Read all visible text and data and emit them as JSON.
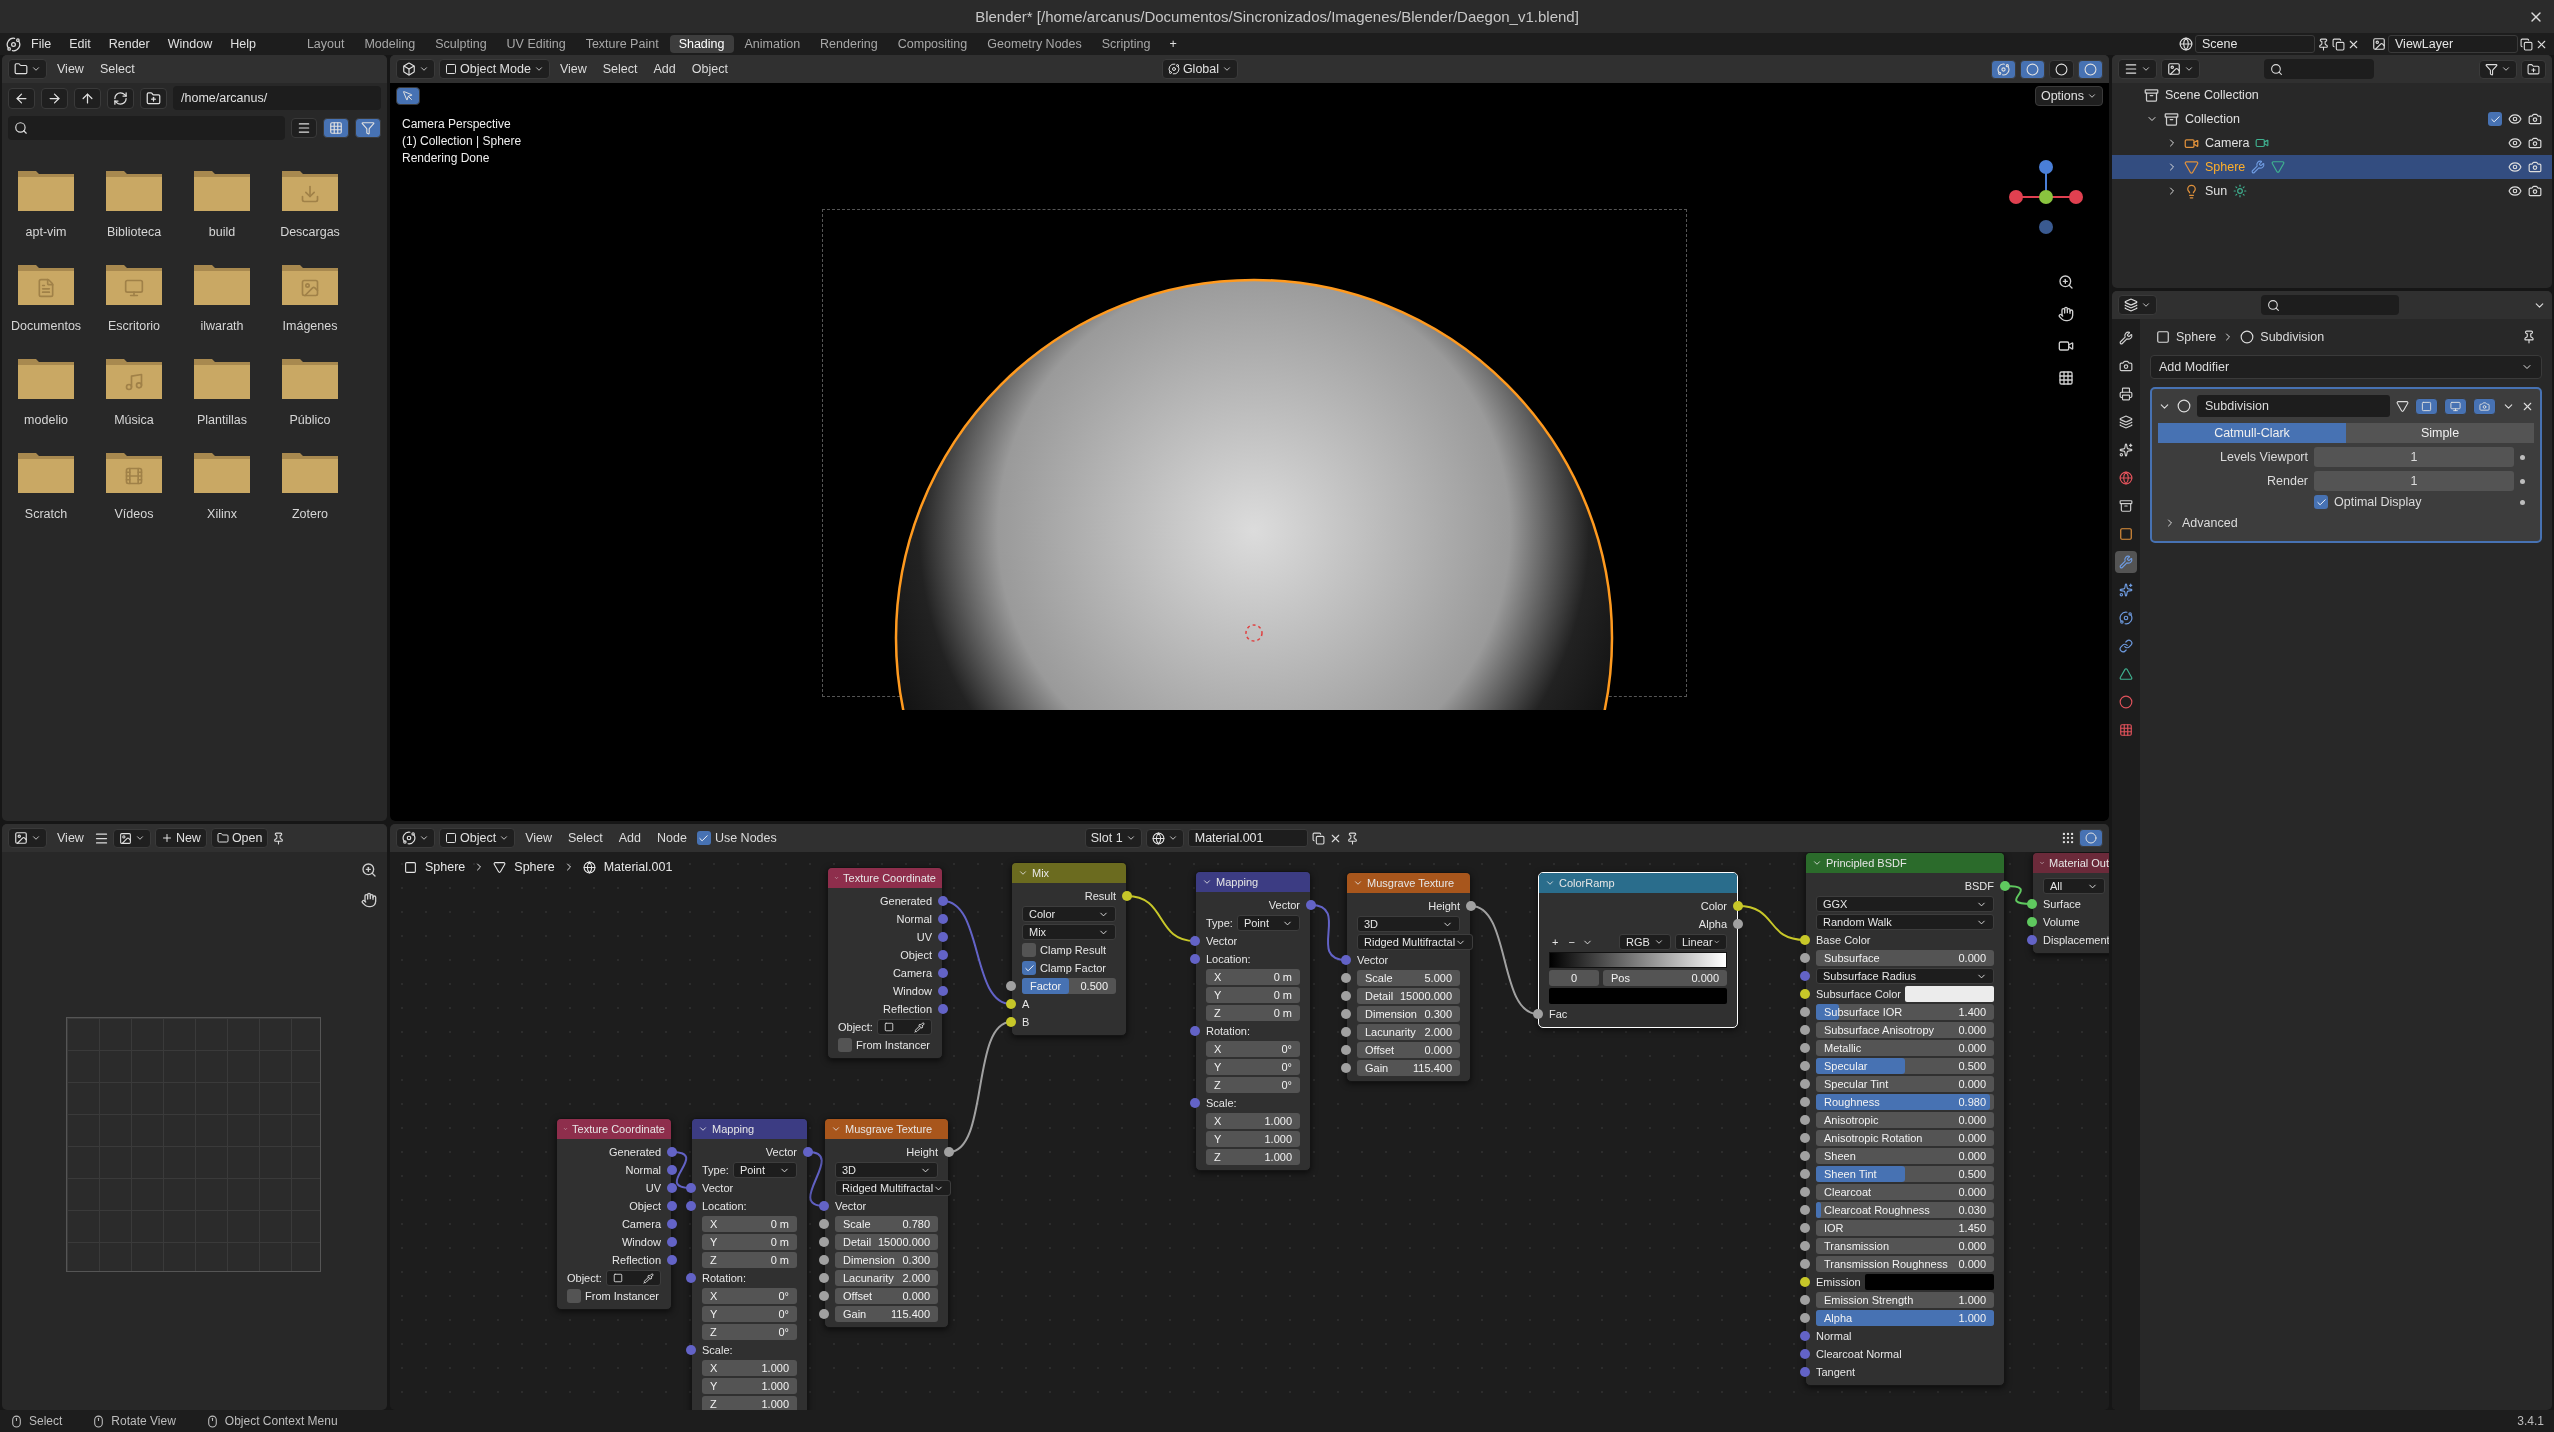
{
  "window": {
    "title": "Blender* [/home/arcanus/Documentos/Sincronizados/Imagenes/Blender/Daegon_v1.blend]"
  },
  "menu": [
    "File",
    "Edit",
    "Render",
    "Window",
    "Help"
  ],
  "workspaces": [
    {
      "label": "Layout",
      "selected": false
    },
    {
      "label": "Modeling",
      "selected": false
    },
    {
      "label": "Sculpting",
      "selected": false
    },
    {
      "label": "UV Editing",
      "selected": false
    },
    {
      "label": "Texture Paint",
      "selected": false
    },
    {
      "label": "Shading",
      "selected": true
    },
    {
      "label": "Animation",
      "selected": false
    },
    {
      "label": "Rendering",
      "selected": false
    },
    {
      "label": "Compositing",
      "selected": false
    },
    {
      "label": "Geometry Nodes",
      "selected": false
    },
    {
      "label": "Scripting",
      "selected": false
    }
  ],
  "workspace_add": "+",
  "scene": "Scene",
  "view_layer": "ViewLayer",
  "file_browser": {
    "menu": [
      "View",
      "Select"
    ],
    "path": "/home/arcanus/",
    "folders": [
      {
        "name": "apt-vim",
        "kind": "plain"
      },
      {
        "name": "Biblioteca",
        "kind": "plain"
      },
      {
        "name": "build",
        "kind": "plain"
      },
      {
        "name": "Descargas",
        "kind": "downloads"
      },
      {
        "name": "Documentos",
        "kind": "documents"
      },
      {
        "name": "Escritorio",
        "kind": "desktop"
      },
      {
        "name": "ilwarath",
        "kind": "plain"
      },
      {
        "name": "Imágenes",
        "kind": "pictures"
      },
      {
        "name": "modelio",
        "kind": "plain"
      },
      {
        "name": "Música",
        "kind": "music"
      },
      {
        "name": "Plantillas",
        "kind": "plain"
      },
      {
        "name": "Público",
        "kind": "plain"
      },
      {
        "name": "Scratch",
        "kind": "plain"
      },
      {
        "name": "Vídeos",
        "kind": "videos"
      },
      {
        "name": "Xilinx",
        "kind": "plain"
      },
      {
        "name": "Zotero",
        "kind": "plain"
      }
    ]
  },
  "image_editor": {
    "menu": [
      "View"
    ],
    "new": "New",
    "open": "Open"
  },
  "viewport": {
    "mode": "Object Mode",
    "menu": [
      "View",
      "Select",
      "Add",
      "Object"
    ],
    "orientation": "Global",
    "options": "Options",
    "overlay": [
      "Camera Perspective",
      "(1) Collection | Sphere",
      "Rendering Done"
    ]
  },
  "node_editor": {
    "type": "Object",
    "menu": [
      "View",
      "Select",
      "Add",
      "Node"
    ],
    "use_nodes": {
      "label": "Use Nodes",
      "checked": true
    },
    "slot": "Slot 1",
    "material": "Material.001",
    "breadcrumbs": [
      "Sphere",
      "Sphere",
      "Material.001"
    ],
    "nodes": [
      {
        "title": "Texture Coordinate",
        "color": "#8e2e4c",
        "selected": false,
        "rows": [
          {
            "kind": "output",
            "label": "Generated",
            "color": "#6363c7"
          },
          {
            "kind": "output",
            "label": "Normal",
            "color": "#6363c7"
          },
          {
            "kind": "output",
            "label": "UV",
            "color": "#6363c7"
          },
          {
            "kind": "output",
            "label": "Object",
            "color": "#6363c7"
          },
          {
            "kind": "output",
            "label": "Camera",
            "color": "#6363c7"
          },
          {
            "kind": "output",
            "label": "Window",
            "color": "#6363c7"
          },
          {
            "kind": "output",
            "label": "Reflection",
            "color": "#6363c7"
          },
          {
            "kind": "object",
            "label": "Object:"
          },
          {
            "kind": "checkbox",
            "label": "From Instancer",
            "checked": false
          }
        ]
      },
      {
        "title": "Mix",
        "color": "#6b6b1f",
        "selected": false,
        "rows": [
          {
            "kind": "output",
            "label": "Result",
            "color": "#c7c729"
          },
          {
            "kind": "select",
            "value": "Color"
          },
          {
            "kind": "select",
            "value": "Mix"
          },
          {
            "kind": "checkbox",
            "label": "Clamp Result",
            "checked": false
          },
          {
            "kind": "checkbox",
            "label": "Clamp Factor",
            "checked": true
          },
          {
            "kind": "value",
            "label": "Factor",
            "value": "0.500",
            "level": 0.5,
            "color": "#a1a1a1"
          },
          {
            "kind": "input",
            "label": "A",
            "color": "#c7c729"
          },
          {
            "kind": "input",
            "label": "B",
            "color": "#c7c729"
          }
        ]
      },
      {
        "title": "Mapping",
        "color": "#3c3c83",
        "selected": false,
        "rows": [
          {
            "kind": "output",
            "label": "Vector",
            "color": "#6363c7"
          },
          {
            "kind": "select",
            "label": "Type:",
            "value": "Point"
          },
          {
            "kind": "input",
            "label": "Vector",
            "color": "#6363c7"
          },
          {
            "kind": "input",
            "label": "Location:",
            "color": "#6363c7"
          },
          {
            "kind": "value",
            "label": "X",
            "value": "0 m"
          },
          {
            "kind": "value",
            "label": "Y",
            "value": "0 m"
          },
          {
            "kind": "value",
            "label": "Z",
            "value": "0 m"
          },
          {
            "kind": "input",
            "label": "Rotation:",
            "color": "#6363c7"
          },
          {
            "kind": "value",
            "label": "X",
            "value": "0°"
          },
          {
            "kind": "value",
            "label": "Y",
            "value": "0°"
          },
          {
            "kind": "value",
            "label": "Z",
            "value": "0°"
          },
          {
            "kind": "input",
            "label": "Scale:",
            "color": "#6363c7"
          },
          {
            "kind": "value",
            "label": "X",
            "value": "1.000"
          },
          {
            "kind": "value",
            "label": "Y",
            "value": "1.000"
          },
          {
            "kind": "value",
            "label": "Z",
            "value": "1.000"
          }
        ]
      },
      {
        "title": "Musgrave Texture",
        "color": "#a8561c",
        "selected": false,
        "rows": [
          {
            "kind": "output",
            "label": "Height",
            "color": "#a1a1a1"
          },
          {
            "kind": "select",
            "value": "3D"
          },
          {
            "kind": "select",
            "value": "Ridged Multifractal"
          },
          {
            "kind": "input",
            "label": "Vector",
            "color": "#6363c7"
          },
          {
            "kind": "value",
            "label": "Scale",
            "value": "5.000",
            "color": "#a1a1a1"
          },
          {
            "kind": "value",
            "label": "Detail",
            "value": "15000.000",
            "color": "#a1a1a1"
          },
          {
            "kind": "value",
            "label": "Dimension",
            "value": "0.300",
            "color": "#a1a1a1"
          },
          {
            "kind": "value",
            "label": "Lacunarity",
            "value": "2.000",
            "color": "#a1a1a1"
          },
          {
            "kind": "value",
            "label": "Offset",
            "value": "0.000",
            "color": "#a1a1a1"
          },
          {
            "kind": "value",
            "label": "Gain",
            "value": "115.400",
            "color": "#a1a1a1"
          }
        ]
      },
      {
        "title": "ColorRamp",
        "color": "#2a6d8c",
        "selected": true,
        "rows": [
          {
            "kind": "output",
            "label": "Color",
            "color": "#c7c729"
          },
          {
            "kind": "output",
            "label": "Alpha",
            "color": "#a1a1a1"
          },
          {
            "kind": "ramp_tools",
            "items": [
              "+",
              "−"
            ],
            "selects": [
              "RGB",
              "Linear"
            ]
          },
          {
            "kind": "ramp"
          },
          {
            "kind": "ramp_fields",
            "index": "0",
            "label": "Pos",
            "value": "0.000"
          },
          {
            "kind": "swatch",
            "swatch": {
              "color": "#000000"
            }
          },
          {
            "kind": "input",
            "label": "Fac",
            "color": "#a1a1a1"
          }
        ]
      },
      {
        "title": "Principled BSDF",
        "color": "#2b6b2b",
        "selected": false,
        "rows": [
          {
            "kind": "output",
            "label": "BSDF",
            "color": "#5fc95f"
          },
          {
            "kind": "select",
            "value": "GGX"
          },
          {
            "kind": "select",
            "value": "Random Walk"
          },
          {
            "kind": "input",
            "label": "Base Color",
            "color": "#c7c729"
          },
          {
            "kind": "value",
            "label": "Subsurface",
            "value": "0.000",
            "color": "#a1a1a1"
          },
          {
            "kind": "select",
            "value": "Subsurface Radius",
            "color": "#6363c7"
          },
          {
            "kind": "swatch",
            "label": "Subsurface Color",
            "color": "#c7c729",
            "swatch": {
              "color": "#ececec"
            }
          },
          {
            "kind": "value",
            "label": "Subsurface IOR",
            "value": "1.400",
            "level": 0.13,
            "color": "#a1a1a1"
          },
          {
            "kind": "value",
            "label": "Subsurface Anisotropy",
            "value": "0.000",
            "color": "#a1a1a1"
          },
          {
            "kind": "value",
            "label": "Metallic",
            "value": "0.000",
            "color": "#a1a1a1"
          },
          {
            "kind": "value",
            "label": "Specular",
            "value": "0.500",
            "level": 0.5,
            "color": "#a1a1a1"
          },
          {
            "kind": "value",
            "label": "Specular Tint",
            "value": "0.000",
            "color": "#a1a1a1"
          },
          {
            "kind": "value",
            "label": "Roughness",
            "value": "0.980",
            "level": 0.98,
            "color": "#a1a1a1"
          },
          {
            "kind": "value",
            "label": "Anisotropic",
            "value": "0.000",
            "color": "#a1a1a1"
          },
          {
            "kind": "value",
            "label": "Anisotropic Rotation",
            "value": "0.000",
            "color": "#a1a1a1"
          },
          {
            "kind": "value",
            "label": "Sheen",
            "value": "0.000",
            "color": "#a1a1a1"
          },
          {
            "kind": "value",
            "label": "Sheen Tint",
            "value": "0.500",
            "level": 0.5,
            "color": "#a1a1a1"
          },
          {
            "kind": "value",
            "label": "Clearcoat",
            "value": "0.000",
            "color": "#a1a1a1"
          },
          {
            "kind": "value",
            "label": "Clearcoat Roughness",
            "value": "0.030",
            "level": 0.03,
            "color": "#a1a1a1"
          },
          {
            "kind": "value",
            "label": "IOR",
            "value": "1.450",
            "color": "#a1a1a1"
          },
          {
            "kind": "value",
            "label": "Transmission",
            "value": "0.000",
            "color": "#a1a1a1"
          },
          {
            "kind": "value",
            "label": "Transmission Roughness",
            "value": "0.000",
            "color": "#a1a1a1"
          },
          {
            "kind": "swatch",
            "label": "Emission",
            "color": "#c7c729",
            "swatch": {
              "color": "#000000"
            }
          },
          {
            "kind": "value",
            "label": "Emission Strength",
            "value": "1.000",
            "color": "#a1a1a1"
          },
          {
            "kind": "value",
            "label": "Alpha",
            "value": "1.000",
            "level": 1,
            "color": "#a1a1a1"
          },
          {
            "kind": "input",
            "label": "Normal",
            "color": "#6363c7"
          },
          {
            "kind": "input",
            "label": "Clearcoat Normal",
            "color": "#6363c7"
          },
          {
            "kind": "input",
            "label": "Tangent",
            "color": "#6363c7"
          }
        ]
      },
      {
        "title": "Material Out",
        "color": "#6b2a3a",
        "selected": false,
        "rows": [
          {
            "kind": "select",
            "value": "All"
          },
          {
            "kind": "input",
            "label": "Surface",
            "color": "#5fc95f"
          },
          {
            "kind": "input",
            "label": "Volume",
            "color": "#5fc95f"
          },
          {
            "kind": "input",
            "label": "Displacement",
            "color": "#6363c7"
          }
        ]
      },
      {
        "title": "Texture Coordinate",
        "color": "#8e2e4c",
        "selected": false,
        "rows": [
          {
            "kind": "output",
            "label": "Generated",
            "color": "#6363c7"
          },
          {
            "kind": "output",
            "label": "Normal",
            "color": "#6363c7"
          },
          {
            "kind": "output",
            "label": "UV",
            "color": "#6363c7"
          },
          {
            "kind": "output",
            "label": "Object",
            "color": "#6363c7"
          },
          {
            "kind": "output",
            "label": "Camera",
            "color": "#6363c7"
          },
          {
            "kind": "output",
            "label": "Window",
            "color": "#6363c7"
          },
          {
            "kind": "output",
            "label": "Reflection",
            "color": "#6363c7"
          },
          {
            "kind": "object",
            "label": "Object:"
          },
          {
            "kind": "checkbox",
            "label": "From Instancer",
            "checked": false
          }
        ]
      },
      {
        "title": "Mapping",
        "color": "#3c3c83",
        "selected": false,
        "rows": [
          {
            "kind": "output",
            "label": "Vector",
            "color": "#6363c7"
          },
          {
            "kind": "select",
            "label": "Type:",
            "value": "Point"
          },
          {
            "kind": "input",
            "label": "Vector",
            "color": "#6363c7"
          },
          {
            "kind": "input",
            "label": "Location:",
            "color": "#6363c7"
          },
          {
            "kind": "value",
            "label": "X",
            "value": "0 m"
          },
          {
            "kind": "value",
            "label": "Y",
            "value": "0 m"
          },
          {
            "kind": "value",
            "label": "Z",
            "value": "0 m"
          },
          {
            "kind": "input",
            "label": "Rotation:",
            "color": "#6363c7"
          },
          {
            "kind": "value",
            "label": "X",
            "value": "0°"
          },
          {
            "kind": "value",
            "label": "Y",
            "value": "0°"
          },
          {
            "kind": "value",
            "label": "Z",
            "value": "0°"
          },
          {
            "kind": "input",
            "label": "Scale:",
            "color": "#6363c7"
          },
          {
            "kind": "value",
            "label": "X",
            "value": "1.000"
          },
          {
            "kind": "value",
            "label": "Y",
            "value": "1.000"
          },
          {
            "kind": "value",
            "label": "Z",
            "value": "1.000"
          }
        ]
      },
      {
        "title": "Musgrave Texture",
        "color": "#a8561c",
        "selected": false,
        "rows": [
          {
            "kind": "output",
            "label": "Height",
            "color": "#a1a1a1"
          },
          {
            "kind": "select",
            "value": "3D"
          },
          {
            "kind": "select",
            "value": "Ridged Multifractal"
          },
          {
            "kind": "input",
            "label": "Vector",
            "color": "#6363c7"
          },
          {
            "kind": "value",
            "label": "Scale",
            "value": "0.780",
            "color": "#a1a1a1"
          },
          {
            "kind": "value",
            "label": "Detail",
            "value": "15000.000",
            "color": "#a1a1a1"
          },
          {
            "kind": "value",
            "label": "Dimension",
            "value": "0.300",
            "color": "#a1a1a1"
          },
          {
            "kind": "value",
            "label": "Lacunarity",
            "value": "2.000",
            "color": "#a1a1a1"
          },
          {
            "kind": "value",
            "label": "Offset",
            "value": "0.000",
            "color": "#a1a1a1"
          },
          {
            "kind": "value",
            "label": "Gain",
            "value": "115.400",
            "color": "#a1a1a1"
          }
        ]
      }
    ]
  },
  "outliner": {
    "tree": [
      {
        "label": "Scene Collection",
        "kind": "scene",
        "selected": false,
        "children": [
          {
            "label": "Collection",
            "kind": "collection",
            "expanded": true,
            "checked": true,
            "selected": false,
            "children": [
              {
                "label": "Camera",
                "kind": "camera",
                "expanded": false,
                "selected": false
              },
              {
                "label": "Sphere",
                "kind": "mesh",
                "expanded": false,
                "selected": true
              },
              {
                "label": "Sun",
                "kind": "light",
                "expanded": false,
                "selected": false
              }
            ]
          }
        ]
      }
    ]
  },
  "properties": {
    "tabs": [
      {
        "kind": "tool",
        "selected": false
      },
      {
        "kind": "render",
        "selected": false
      },
      {
        "kind": "output",
        "selected": false
      },
      {
        "kind": "view_layer",
        "selected": false
      },
      {
        "kind": "scene",
        "selected": false
      },
      {
        "kind": "world",
        "selected": false
      },
      {
        "kind": "collection",
        "selected": false
      },
      {
        "kind": "object",
        "selected": false
      },
      {
        "kind": "modifiers",
        "selected": true
      },
      {
        "kind": "particles",
        "selected": false
      },
      {
        "kind": "physics",
        "selected": false
      },
      {
        "kind": "constraints",
        "selected": false
      },
      {
        "kind": "data",
        "selected": false
      },
      {
        "kind": "material",
        "selected": false
      },
      {
        "kind": "texture",
        "selected": false
      }
    ],
    "breadcrumbs": [
      "Sphere",
      "Subdivision"
    ],
    "add_modifier": "Add Modifier",
    "modifier": {
      "name": "Subdivision",
      "expanded": true,
      "tabs": [
        {
          "label": "Catmull-Clark",
          "selected": true
        },
        {
          "label": "Simple",
          "selected": false
        }
      ],
      "fields": [
        {
          "label": "Levels Viewport",
          "value": "1"
        },
        {
          "label": "Render",
          "value": "1"
        }
      ],
      "optimal_display": {
        "label": "Optimal Display",
        "checked": true
      },
      "advanced": {
        "label": "Advanced",
        "expanded": false
      }
    }
  },
  "status_bar": {
    "hints": [
      "Select",
      "Rotate View",
      "Object Context Menu"
    ],
    "version": "3.4.1"
  }
}
